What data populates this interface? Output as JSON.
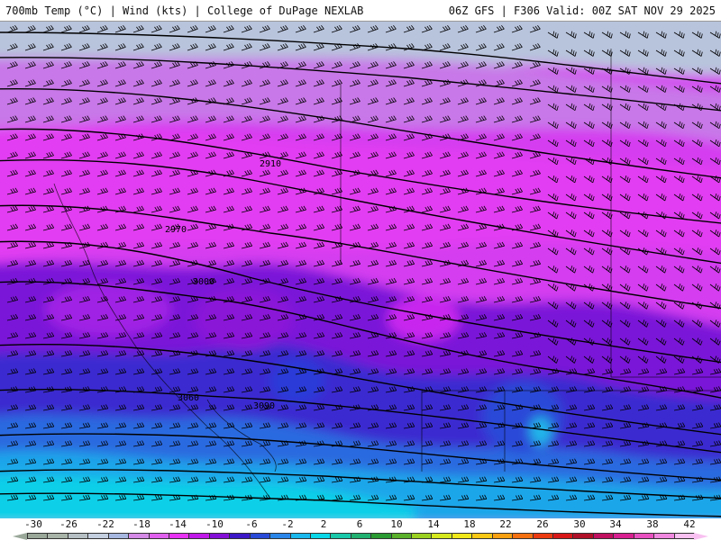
{
  "header": {
    "left_text": "700mb Temp (°C) | Wind (kts) | College of DuPage NEXLAB",
    "right_text": "06Z GFS | F306 Valid: 00Z SAT NOV 29 2025"
  },
  "contour_labels": [
    "2910",
    "2970",
    "3000",
    "3060",
    "3090"
  ],
  "colorbar": {
    "tick_labels": [
      "-30",
      "-26",
      "-22",
      "-18",
      "-14",
      "-10",
      "-6",
      "-2",
      "2",
      "6",
      "10",
      "14",
      "18",
      "22",
      "26",
      "30",
      "34",
      "38",
      "42"
    ],
    "colors": [
      "#9aa89a",
      "#a8b4a8",
      "#b6c0c4",
      "#c4cfe0",
      "#a7b8e0",
      "#d48ae6",
      "#e060ee",
      "#e832f4",
      "#c018e8",
      "#8410d8",
      "#3c18c8",
      "#2a4ad8",
      "#2a86e8",
      "#1ab8ec",
      "#0ad8e8",
      "#18c8a8",
      "#20b070",
      "#2a9a32",
      "#5ab02a",
      "#9ad020",
      "#d4e81c",
      "#f0e818",
      "#f8c814",
      "#f8a010",
      "#f47010",
      "#ec3a10",
      "#d81818",
      "#b01028",
      "#c01060",
      "#d82090",
      "#e850c0",
      "#f088e0",
      "#f8c0f0"
    ]
  }
}
